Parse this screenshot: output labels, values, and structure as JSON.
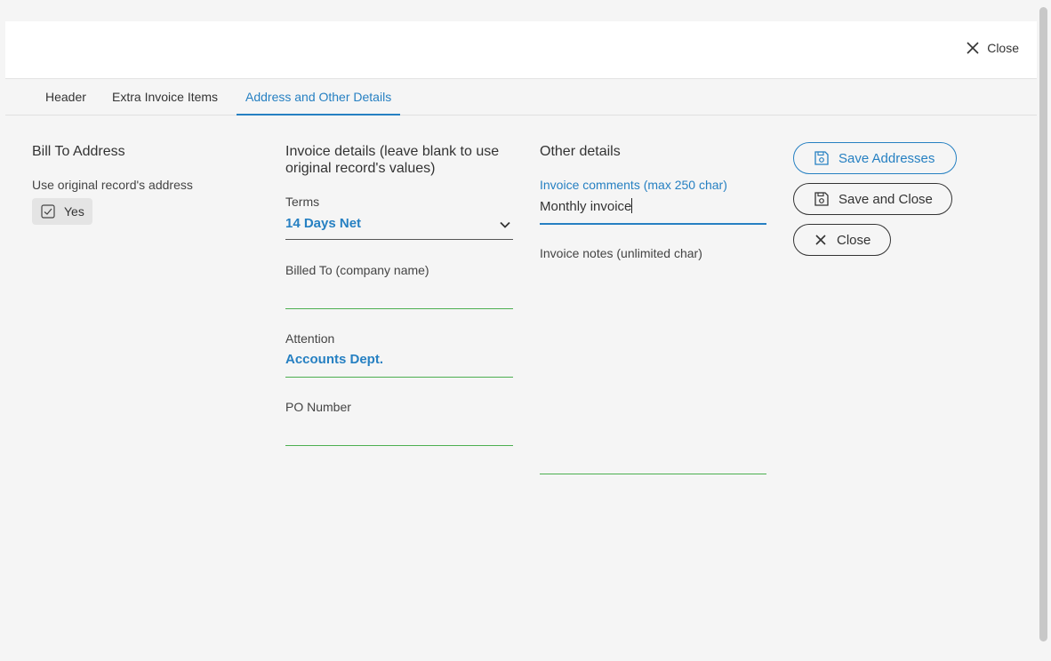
{
  "header": {
    "close_label": "Close"
  },
  "tabs": [
    {
      "label": "Header"
    },
    {
      "label": "Extra Invoice Items"
    },
    {
      "label": "Address and Other Details",
      "active": true
    }
  ],
  "bill_to": {
    "title": "Bill To Address",
    "use_original_label": "Use original record's address",
    "use_original_value": "Yes"
  },
  "invoice_details": {
    "title": "Invoice details (leave blank to use original record's values)",
    "terms_label": "Terms",
    "terms_value": "14 Days Net",
    "billed_to_label": "Billed To (company name)",
    "billed_to_value": "",
    "attention_label": "Attention",
    "attention_value": "Accounts Dept.",
    "po_label": "PO Number",
    "po_value": ""
  },
  "other_details": {
    "title": "Other details",
    "comments_label": "Invoice comments (max 250 char)",
    "comments_value": "Monthly invoice",
    "notes_label": "Invoice notes (unlimited char)",
    "notes_value": ""
  },
  "actions": {
    "save_addresses": "Save Addresses",
    "save_and_close": "Save and Close",
    "close": "Close"
  },
  "colors": {
    "accent": "#2680c2",
    "field_line": "#4caf50"
  }
}
